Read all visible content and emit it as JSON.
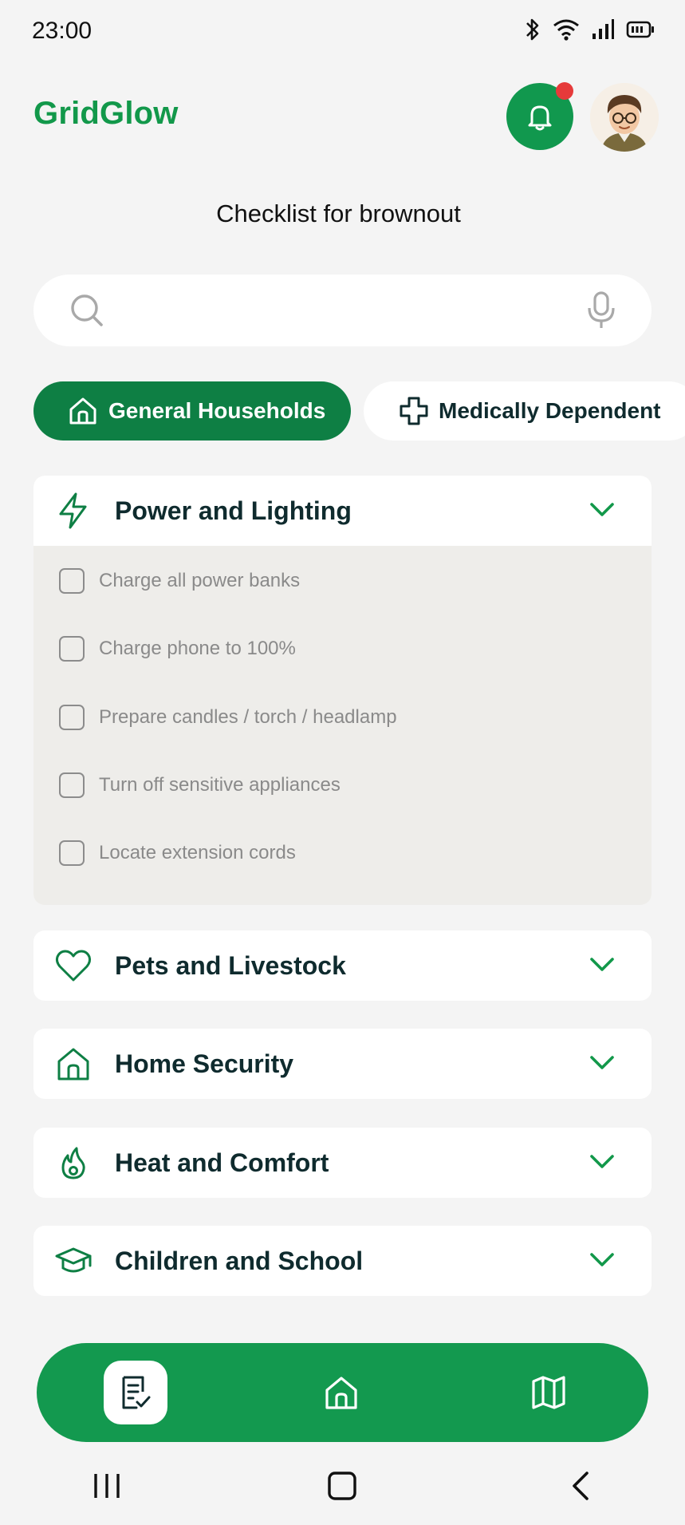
{
  "status_bar": {
    "time": "23:00",
    "icons": [
      "bluetooth-icon",
      "wifi-icon",
      "signal-icon",
      "battery-icon"
    ]
  },
  "header": {
    "app_name": "GridGlow",
    "notification_has_badge": true,
    "avatar": "user-avatar"
  },
  "page": {
    "title": "Checklist for brownout"
  },
  "search": {
    "placeholder": "",
    "value": ""
  },
  "filters": [
    {
      "label": "General Households",
      "icon": "home-icon",
      "selected": true
    },
    {
      "label": "Medically Dependent",
      "icon": "medical-cross-icon",
      "selected": false
    }
  ],
  "sections": [
    {
      "title": "Power and Lighting",
      "icon": "lightning-icon",
      "expanded": true,
      "items": [
        {
          "label": "Charge all power banks",
          "checked": false
        },
        {
          "label": "Charge phone to 100%",
          "checked": false
        },
        {
          "label": "Prepare candles / torch / headlamp",
          "checked": false
        },
        {
          "label": "Turn off sensitive appliances",
          "checked": false
        },
        {
          "label": "Locate extension cords",
          "checked": false
        }
      ]
    },
    {
      "title": "Pets and Livestock",
      "icon": "heart-icon",
      "expanded": false
    },
    {
      "title": "Home Security",
      "icon": "home-icon",
      "expanded": false
    },
    {
      "title": "Heat and Comfort",
      "icon": "flame-icon",
      "expanded": false
    },
    {
      "title": "Children and School",
      "icon": "graduation-cap-icon",
      "expanded": false
    }
  ],
  "bottom_nav": [
    {
      "name": "checklist",
      "icon": "checklist-icon",
      "active": true
    },
    {
      "name": "home",
      "icon": "home-icon",
      "active": false
    },
    {
      "name": "map",
      "icon": "map-icon",
      "active": false
    }
  ],
  "colors": {
    "brand_green": "#12984a",
    "chip_active": "#0e7f44",
    "text_dark": "#0f2b2e",
    "badge_red": "#e63a3a"
  }
}
